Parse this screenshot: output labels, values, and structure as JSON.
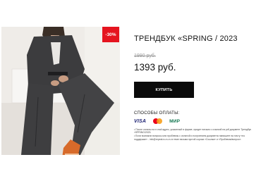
{
  "product": {
    "discount_badge": "-30%",
    "title": "ТРЕНДБУК «SPRING / 2023",
    "old_price": "1990 руб.",
    "new_price": "1393 руб.",
    "buy_label": "КУПИТЬ"
  },
  "payment": {
    "heading": "СПОСОБЫ ОПЛАТЫ:",
    "methods": [
      {
        "name": "VISA",
        "icon": "visa-logo"
      },
      {
        "name": "mastercard",
        "icon": "mastercard-logo"
      },
      {
        "name": "МИР",
        "icon": "mir-logo"
      }
    ]
  },
  "notes": [
    "• После оплаты на e-mail адрес, указанный в форме, придет письмо с ссылкой на pdf документ Трендбук «SPRING/2023.",
    "• Если возникли вопросы или проблемы с оплатой и получением документа напишите на почту «по поддержке» - info@repeat.ru.ru.ru в теме письма пустой сорока «Ссылка» и «Проблема/вопрос»."
  ],
  "colors": {
    "badge": "#e5141f",
    "button": "#0a0a0a",
    "visa": "#1a1f71",
    "mir": "#0f754e"
  }
}
